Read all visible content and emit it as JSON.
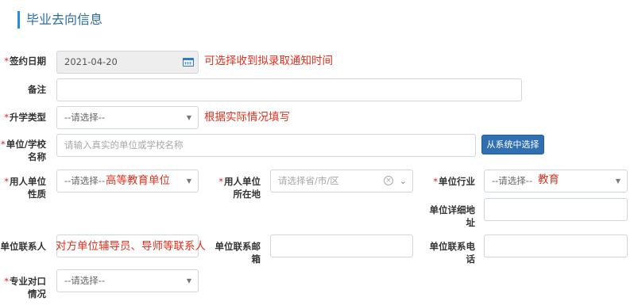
{
  "section": {
    "title": "毕业去向信息"
  },
  "fields": {
    "sign_date": {
      "required": "*",
      "label": "签约日期",
      "value": "2021-04-20",
      "note": "可选择收到拟录取通知时间"
    },
    "remarks": {
      "label": "备注",
      "value": ""
    },
    "further_study_type": {
      "required": "*",
      "label": "升学类型",
      "value": "--请选择--",
      "note": "根据实际情况填写"
    },
    "employer": {
      "required": "*",
      "label": "单位/学校名称",
      "placeholder": "请输入真实的单位或学校名称",
      "button": "从系统中选择"
    },
    "employer_nature": {
      "required": "*",
      "label": "用人单位性质",
      "value": "--请选择--",
      "note": "高等教育单位"
    },
    "employer_location": {
      "required": "*",
      "label": "用人单位所在地",
      "placeholder": "请选择省/市/区"
    },
    "industry": {
      "required": "*",
      "label": "单位行业",
      "value": "--请选择--",
      "note": "教育"
    },
    "address": {
      "label": "单位详细地址",
      "value": ""
    },
    "contact_person": {
      "label": "单位联系人",
      "note": "对方单位辅导员、导师等联系人"
    },
    "contact_email": {
      "label": "单位联系邮箱",
      "value": ""
    },
    "contact_phone": {
      "label": "单位联系电话",
      "value": ""
    },
    "major_match": {
      "required": "*",
      "label": "专业对口情况",
      "value": "--请选择--"
    }
  },
  "icons": {
    "date_picker": "calendar-icon",
    "select": "caret-down-icon",
    "clear": "clear-circle-icon",
    "cascader": "chevron-down-icon"
  },
  "colors": {
    "accent": "#2a8bd8",
    "note_red": "#e0301e",
    "button_blue": "#2f6fb2",
    "required": "#e02020"
  }
}
